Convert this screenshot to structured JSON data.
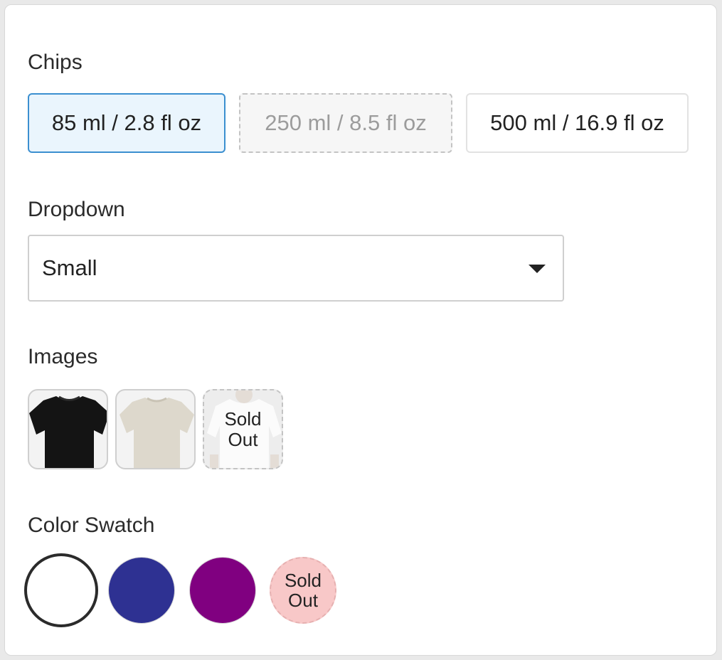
{
  "sections": {
    "chips_title": "Chips",
    "dropdown_title": "Dropdown",
    "images_title": "Images",
    "swatch_title": "Color Swatch"
  },
  "chips": [
    {
      "label": "85 ml / 2.8 fl oz",
      "state": "selected"
    },
    {
      "label": "250 ml / 8.5 fl oz",
      "state": "disabled"
    },
    {
      "label": "500 ml / 16.9 fl oz",
      "state": "default"
    }
  ],
  "dropdown": {
    "value": "Small",
    "icon": "caret-down-icon"
  },
  "images": [
    {
      "name": "black-tshirt",
      "state": "selected",
      "color": "#111111"
    },
    {
      "name": "beige-tshirt",
      "state": "default",
      "color": "#ddd8cc"
    },
    {
      "name": "white-tshirt",
      "state": "sold-out",
      "color": "#f4f4f4",
      "label": "Sold\nOut"
    }
  ],
  "swatches": [
    {
      "name": "white",
      "color": "#ffffff",
      "state": "selected"
    },
    {
      "name": "blue",
      "color": "#2e3192",
      "state": "default"
    },
    {
      "name": "purple",
      "color": "#800080",
      "state": "default"
    },
    {
      "name": "pink",
      "color": "#f8c8c8",
      "state": "sold-out",
      "label": "Sold\nOut"
    }
  ]
}
